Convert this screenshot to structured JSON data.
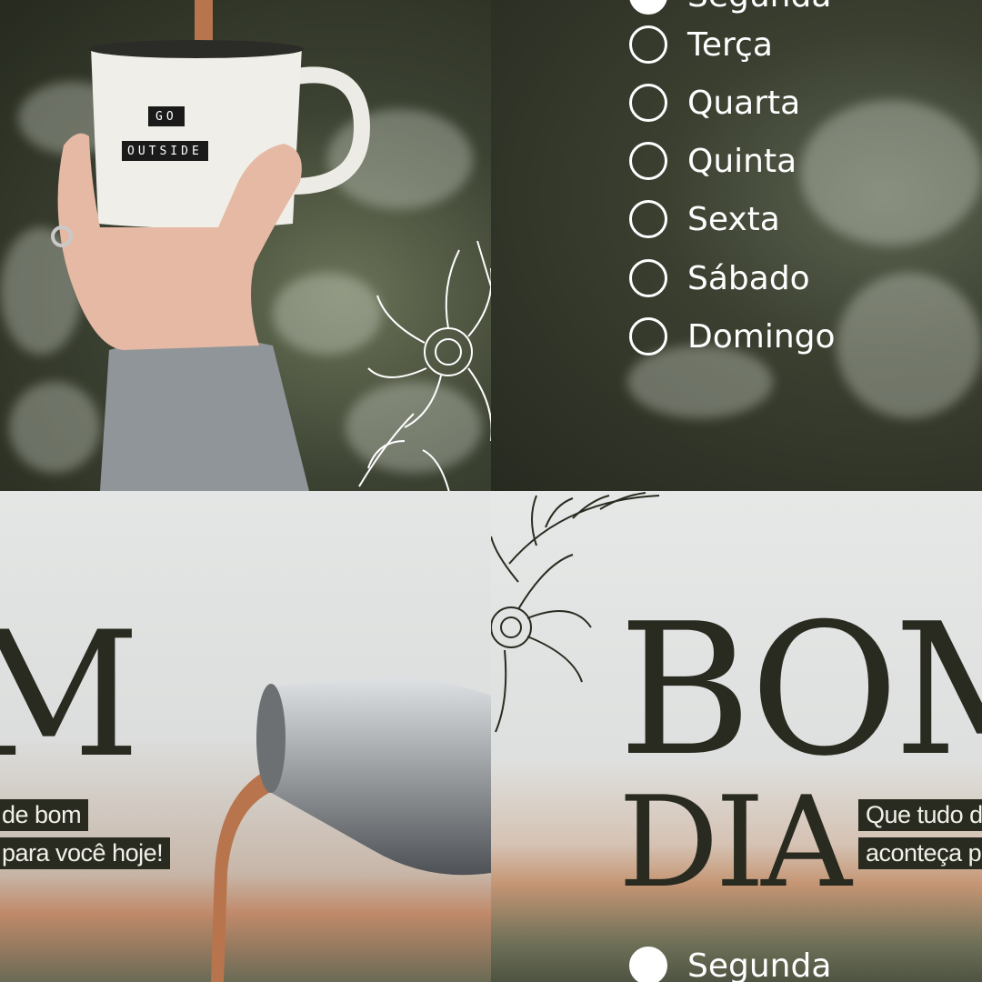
{
  "mug": {
    "line1": "GO",
    "line2": "OUTSIDE"
  },
  "headline": {
    "word1": "BOM",
    "word2": "DIA",
    "word1_fragment": "M"
  },
  "tagline": {
    "line1": "Que tudo de bom",
    "line2": "aconteça para você hoje!",
    "line1_visible_left": "de bom",
    "line2_visible_left": "para você hoje!",
    "line1_visible_right": "Que tudo d",
    "line2_visible_right": "aconteça p"
  },
  "days": {
    "segunda": "Segunda",
    "terca": "Terça",
    "quarta": "Quarta",
    "quinta": "Quinta",
    "sexta": "Sexta",
    "sabado": "Sábado",
    "domingo": "Domingo"
  },
  "colors": {
    "dark": "#2a2b20",
    "white": "#ffffff",
    "coffee": "#b8744c"
  }
}
